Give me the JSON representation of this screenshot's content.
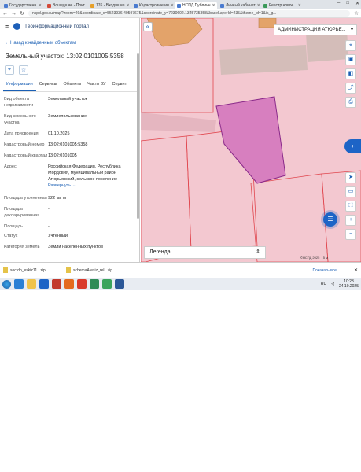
{
  "browser": {
    "tabs": [
      {
        "label": "Государственн"
      },
      {
        "label": "Вошедшие - Почт"
      },
      {
        "label": "176 - Входящие"
      },
      {
        "label": "Кадастровые ин"
      },
      {
        "label": "НСПД Публичн"
      },
      {
        "label": "Личный кабинет"
      },
      {
        "label": "Реестр новое"
      }
    ],
    "url": "nspd.gov.ru/map?zoom=20&coordinate_x=5523936.40597675&coordinate_y=7230602.1345735358&baseLayerId=235&theme_id=1&is_g...",
    "controls": {
      "min": "–",
      "max": "□",
      "close": "✕"
    }
  },
  "portal": {
    "title": "Геоинформационный портал",
    "back_label": "Назад к найденным объектам",
    "object_title": "Земельный участок: 13:02:0101005:5358"
  },
  "tabs": [
    {
      "label": "Информация"
    },
    {
      "label": "Сервисы"
    },
    {
      "label": "Объекты"
    },
    {
      "label": "Части ЗУ"
    },
    {
      "label": "Сервит"
    }
  ],
  "properties": [
    {
      "key": "Вид объекта недвижимости",
      "value": "Земельный участок"
    },
    {
      "key": "Вид земельного участка",
      "value": "Землепользование"
    },
    {
      "key": "Дата присвоения",
      "value": "01.10.2025"
    },
    {
      "key": "Кадастровый номер",
      "value": "13:02:0101005:5358"
    },
    {
      "key": "Кадастровый квартал",
      "value": "13:02:0101005"
    },
    {
      "key": "Адрес",
      "value": "Российская Федерация, Республика Мордовия, муниципальный район Атюрьевский, сельское поселение"
    },
    {
      "key": "Площадь уточненная",
      "value": "922 кв. м"
    },
    {
      "key": "Площадь декларированная",
      "value": "-"
    },
    {
      "key": "Площадь",
      "value": "-"
    },
    {
      "key": "Статус",
      "value": "Учтенный"
    },
    {
      "key": "Категория земель",
      "value": "Земли населенных пунктов"
    }
  ],
  "address_toggle": "Развернуть",
  "map": {
    "region_select": "АДМИНИСТРАЦИЯ АТЮРЬЕ...",
    "legend_label": "Легенда",
    "copyright": "©НСПД 2025",
    "scale": "5 м",
    "colors": {
      "parcel_fill": "#f3c8d0",
      "parcel_border": "#e0464e",
      "selected": "#d77fbf",
      "selected_border": "#8a2a8a",
      "building": "#c9b9b2",
      "orange_zone": "#e3a36a"
    }
  },
  "downloads": [
    {
      "name": "sec.do_eskiz11...zip"
    },
    {
      "name": "schemaAtesiz_rel...zip"
    }
  ],
  "downloads_show_all": "Показать все",
  "taskbar": {
    "lang": "RU",
    "time": "10:23",
    "date": "24.10.2025"
  }
}
